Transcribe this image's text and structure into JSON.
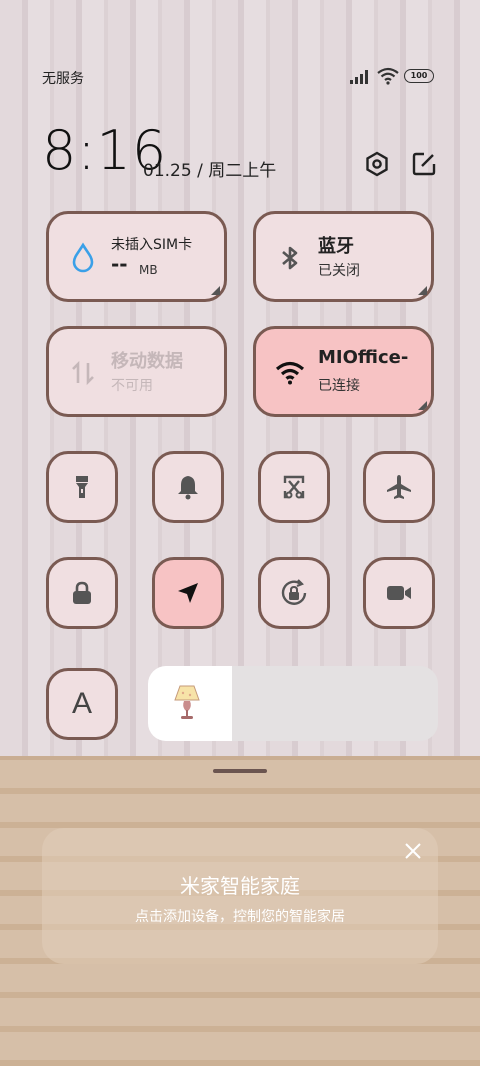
{
  "status_bar": {
    "carrier": "无服务",
    "battery": "100"
  },
  "header": {
    "time": "8:16",
    "date": "01.25 / 周二上午"
  },
  "big_tiles": [
    {
      "title": "未插入SIM卡",
      "value": "--",
      "unit": "MB"
    },
    {
      "title": "蓝牙",
      "subtitle": "已关闭"
    },
    {
      "title": "移动数据",
      "subtitle": "不可用"
    },
    {
      "title": "MIOffice-",
      "subtitle": "已连接"
    }
  ],
  "toggles_row1": [
    "flashlight-icon",
    "bell-icon",
    "screenshot-icon",
    "airplane-icon"
  ],
  "toggles_row2": [
    "lock-icon",
    "location-icon",
    "rotation-lock-icon",
    "screen-record-icon"
  ],
  "bottom_row": {
    "font_button": "A",
    "brightness_fraction": 0.29
  },
  "smart_home": {
    "title": "米家智能家庭",
    "subtitle": "点击添加设备，控制您的智能家居"
  },
  "colors": {
    "tile_border": "#7a5a52",
    "tile_bg": "#f0dfe1",
    "tile_active": "#f7c3c4",
    "accent_blue": "#3aa0e8"
  }
}
